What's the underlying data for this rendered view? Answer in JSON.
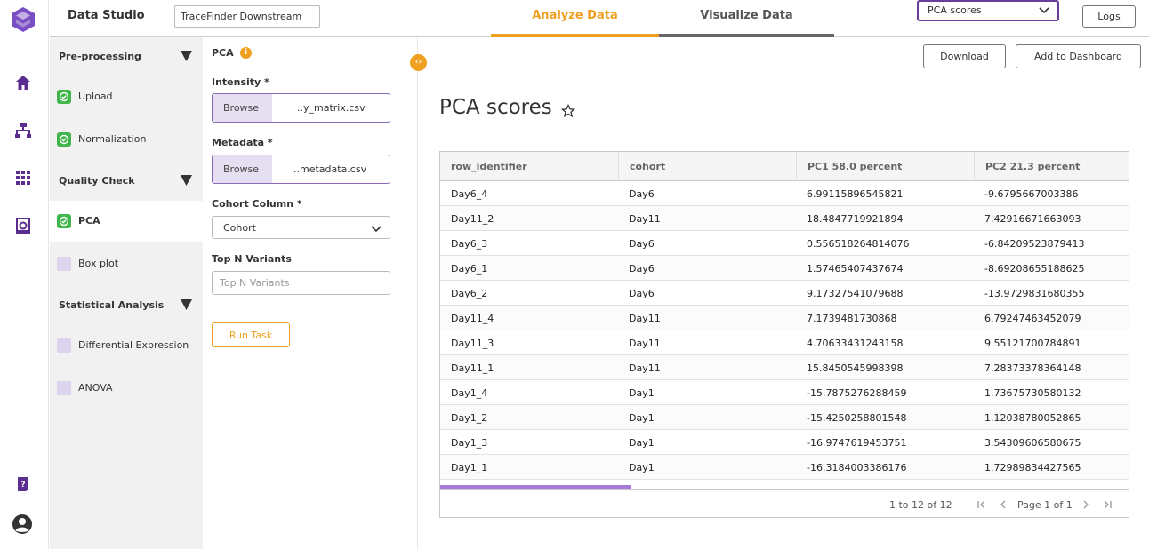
{
  "app": {
    "title": "Data Studio",
    "project": "TraceFinder Downstream"
  },
  "tabs": [
    {
      "label": "Analyze Data",
      "active": true
    },
    {
      "label": "Visualize Data",
      "active": false
    }
  ],
  "view_select": {
    "value": "PCA scores"
  },
  "logs_label": "Logs",
  "rail": [
    "home-icon",
    "workflow-icon",
    "grid-apps-icon",
    "report-icon",
    "help-icon",
    "user-icon"
  ],
  "workflow": {
    "sections": [
      {
        "label": "Pre-processing",
        "steps": [
          {
            "label": "Upload",
            "done": true
          },
          {
            "label": "Normalization",
            "done": true
          }
        ]
      },
      {
        "label": "Quality Check",
        "steps": [
          {
            "label": "PCA",
            "done": true,
            "active": true
          },
          {
            "label": "Box plot",
            "done": false
          }
        ]
      },
      {
        "label": "Statistical Analysis",
        "steps": [
          {
            "label": "Differential Expression",
            "done": false
          },
          {
            "label": "ANOVA",
            "done": false
          }
        ]
      }
    ]
  },
  "form": {
    "title": "PCA",
    "intensity": {
      "label": "Intensity *",
      "browse": "Browse",
      "file": "..y_matrix.csv"
    },
    "metadata": {
      "label": "Metadata *",
      "browse": "Browse",
      "file": "..metadata.csv"
    },
    "cohort_column": {
      "label": "Cohort Column *",
      "value": "Cohort"
    },
    "top_n": {
      "label": "Top N Variants",
      "placeholder": "Top N Variants"
    },
    "run_label": "Run Task"
  },
  "actions": {
    "download": "Download",
    "add_dashboard": "Add to Dashboard"
  },
  "page_title": "PCA scores",
  "table": {
    "columns": [
      "row_identifier",
      "cohort",
      "PC1 58.0 percent",
      "PC2 21.3 percent"
    ],
    "rows": [
      [
        "Day6_4",
        "Day6",
        "6.99115896545821",
        "-9.6795667003386"
      ],
      [
        "Day11_2",
        "Day11",
        "18.4847719921894",
        "7.42916671663093"
      ],
      [
        "Day6_3",
        "Day6",
        "0.556518264814076",
        "-6.84209523879413"
      ],
      [
        "Day6_1",
        "Day6",
        "1.57465407437674",
        "-8.69208655188625"
      ],
      [
        "Day6_2",
        "Day6",
        "9.17327541079688",
        "-13.9729831680355"
      ],
      [
        "Day11_4",
        "Day11",
        "7.1739481730868",
        "6.79247463452079"
      ],
      [
        "Day11_3",
        "Day11",
        "4.70633431243158",
        "9.55121700784891"
      ],
      [
        "Day11_1",
        "Day11",
        "15.8450545998398",
        "7.28373378364148"
      ],
      [
        "Day1_4",
        "Day1",
        "-15.7875276288459",
        "1.73675730580132"
      ],
      [
        "Day1_2",
        "Day1",
        "-15.4250258801548",
        "1.12038780052865"
      ],
      [
        "Day1_3",
        "Day1",
        "-16.9747619453751",
        "3.54309606580675"
      ],
      [
        "Day1_1",
        "Day1",
        "-16.3184003386176",
        "1.72989834427565"
      ]
    ],
    "footer": {
      "count": "1 to 12 of 12",
      "page": "Page 1 of 1"
    }
  },
  "colors": {
    "brand": "#5b2d91",
    "accent": "#f0a020",
    "success": "#3fb54a",
    "select_border": "#6a3d9a"
  }
}
